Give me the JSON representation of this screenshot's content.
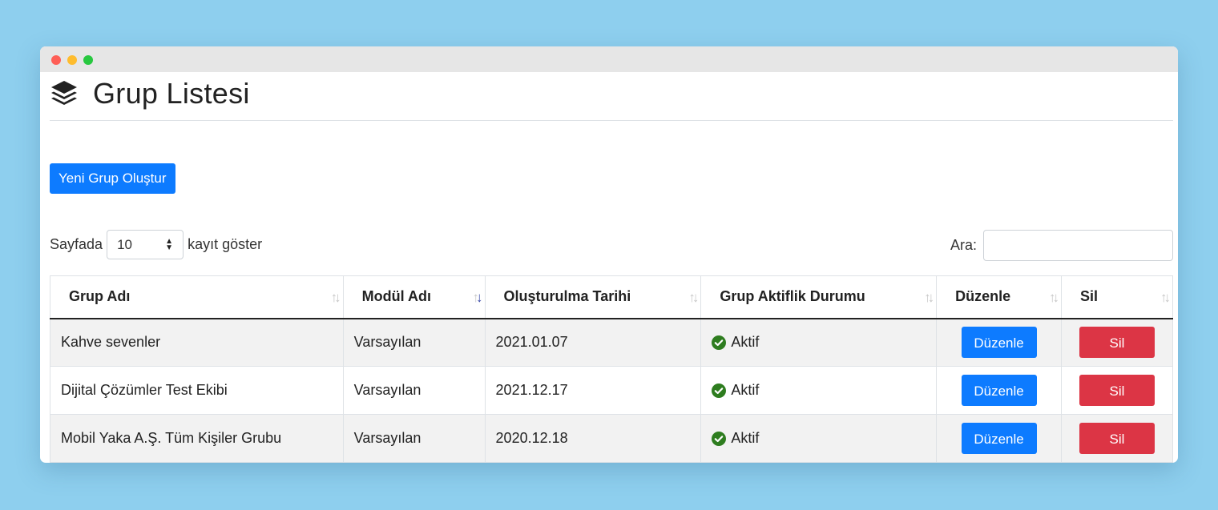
{
  "page": {
    "title": "Grup Listesi",
    "create_button": "Yeni Grup Oluştur"
  },
  "length_control": {
    "prefix": "Sayfada",
    "value": "10",
    "suffix": "kayıt göster"
  },
  "search": {
    "label": "Ara:",
    "value": ""
  },
  "table": {
    "headers": [
      "Grup Adı",
      "Modül Adı",
      "Oluşturulma Tarihi",
      "Grup Aktiflik Durumu",
      "Düzenle",
      "Sil"
    ],
    "rows": [
      {
        "name": "Kahve sevenler",
        "module": "Varsayılan",
        "date": "2021.01.07",
        "status": "Aktif",
        "edit": "Düzenle",
        "delete": "Sil"
      },
      {
        "name": "Dijital Çözümler Test Ekibi",
        "module": "Varsayılan",
        "date": "2021.12.17",
        "status": "Aktif",
        "edit": "Düzenle",
        "delete": "Sil"
      },
      {
        "name": "Mobil Yaka A.Ş. Tüm Kişiler Grubu",
        "module": "Varsayılan",
        "date": "2020.12.18",
        "status": "Aktif",
        "edit": "Düzenle",
        "delete": "Sil"
      }
    ]
  },
  "icons": {
    "logo": "layers-icon",
    "status": "check-circle-icon",
    "sort": "sort-icon"
  },
  "colors": {
    "primary": "#0d7bff",
    "danger": "#dc3545",
    "success": "#2e7d1f",
    "background": "#8ecfee"
  }
}
